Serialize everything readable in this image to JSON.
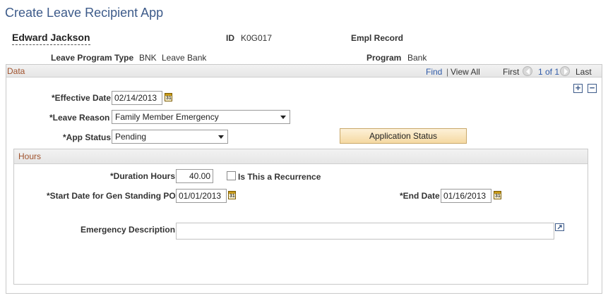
{
  "page": {
    "title": "Create Leave Recipient App"
  },
  "header": {
    "employee_name": "Edward Jackson",
    "id_label": "ID",
    "id_value": "K0G017",
    "empl_record_label": "Empl Record",
    "leave_program_type_label": "Leave Program Type",
    "leave_program_type_code": "BNK",
    "leave_program_type_value": "Leave Bank",
    "program_label": "Program",
    "program_value": "Bank"
  },
  "data_section": {
    "title": "Data",
    "nav": {
      "find": "Find",
      "separator": "|",
      "view_all": "View All",
      "first": "First",
      "range": "1 of 1",
      "last": "Last"
    },
    "add_row": "+",
    "delete_row": "−",
    "effective_date_label": "*Effective Date",
    "effective_date_value": "02/14/2013",
    "leave_reason_label": "*Leave Reason",
    "leave_reason_value": "Family Member Emergency",
    "app_status_label": "*App Status",
    "app_status_value": "Pending",
    "application_status_button": "Application Status",
    "calendar_glyph": "31"
  },
  "hours_section": {
    "title": "Hours",
    "duration_hours_label": "*Duration Hours",
    "duration_hours_value": "40.00",
    "recurrence_label": "Is This a Recurrence",
    "recurrence_checked": false,
    "start_date_label": "*Start Date for Gen Standing PO",
    "start_date_value": "01/01/2013",
    "end_date_label": "*End Date",
    "end_date_value": "01/16/2013",
    "emergency_description_label": "Emergency Description",
    "emergency_description_value": ""
  }
}
